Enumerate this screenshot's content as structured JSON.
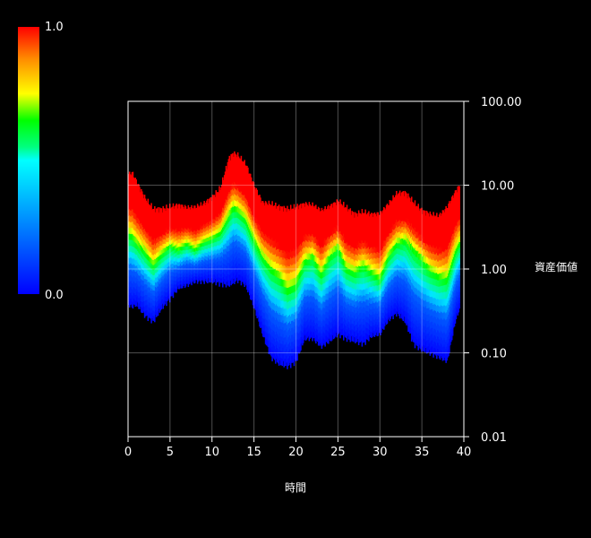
{
  "chart_data": {
    "type": "heatmap",
    "title": "",
    "xlabel": "時間",
    "ylabel": "資産価値",
    "x_scale": "linear",
    "y_scale": "log",
    "xlim": [
      0,
      40
    ],
    "ylim": [
      0.01,
      100
    ],
    "x_ticks": [
      0,
      5,
      10,
      15,
      20,
      25,
      30,
      35,
      40
    ],
    "y_ticks": [
      0.01,
      0.1,
      1,
      10,
      100
    ],
    "x_tick_labels": [
      "0",
      "5",
      "10",
      "15",
      "20",
      "25",
      "30",
      "35",
      "40"
    ],
    "y_tick_labels": [
      "0.01",
      "0.10",
      "1.00",
      "10.00",
      "100.00"
    ],
    "grid": true,
    "colorbar": {
      "min": 0.0,
      "max": 1.0,
      "min_label": "0.0",
      "max_label": "1.0",
      "colormap": [
        "#0000ff",
        "#00c8ff",
        "#00ffff",
        "#00ff00",
        "#ffff00",
        "#ff8c00",
        "#ff0000"
      ],
      "placement": "top-left"
    },
    "x_range_of_data": [
      0,
      39.5
    ],
    "bands": {
      "description": "Per-time columns of asset-value quantiles; color = cumulative probability (0 = blue, 1 = red)",
      "x": [
        0,
        0.5,
        1,
        2,
        3,
        4,
        5,
        6,
        7,
        8,
        9,
        10,
        11,
        12,
        12.5,
        13,
        14,
        15,
        16,
        17,
        18,
        19,
        20,
        21,
        22,
        23,
        24,
        25,
        26,
        27,
        28,
        29,
        30,
        31,
        32,
        33,
        34,
        35,
        36,
        37,
        38,
        39,
        39.5
      ],
      "median": [
        2.6,
        2.4,
        2.0,
        1.6,
        1.1,
        1.5,
        1.9,
        1.7,
        2.0,
        1.7,
        2.1,
        2.3,
        2.7,
        4.2,
        5.4,
        5.0,
        3.8,
        2.2,
        1.4,
        1.0,
        0.8,
        0.55,
        0.65,
        1.2,
        1.4,
        0.85,
        1.4,
        1.8,
        1.0,
        0.9,
        1.1,
        0.9,
        0.75,
        1.4,
        2.0,
        2.2,
        1.7,
        1.3,
        0.95,
        0.8,
        0.75,
        1.6,
        2.0
      ],
      "upper": [
        13.5,
        14.0,
        11.0,
        7.0,
        5.2,
        5.2,
        5.5,
        5.8,
        5.4,
        5.5,
        6.0,
        7.2,
        9.2,
        21.0,
        24.0,
        23.0,
        18.0,
        10.0,
        6.2,
        6.0,
        5.5,
        5.2,
        5.5,
        6.0,
        5.8,
        5.0,
        5.6,
        6.5,
        5.4,
        4.5,
        4.8,
        4.5,
        4.6,
        6.0,
        8.0,
        8.2,
        6.2,
        5.0,
        4.5,
        4.3,
        5.5,
        8.5,
        10.0
      ],
      "lower": [
        0.38,
        0.36,
        0.38,
        0.28,
        0.24,
        0.35,
        0.45,
        0.6,
        0.65,
        0.72,
        0.72,
        0.72,
        0.68,
        0.65,
        0.7,
        0.75,
        0.65,
        0.35,
        0.17,
        0.09,
        0.075,
        0.07,
        0.08,
        0.15,
        0.15,
        0.12,
        0.14,
        0.17,
        0.15,
        0.14,
        0.13,
        0.16,
        0.17,
        0.25,
        0.3,
        0.24,
        0.13,
        0.11,
        0.1,
        0.09,
        0.08,
        0.25,
        0.35
      ]
    }
  }
}
